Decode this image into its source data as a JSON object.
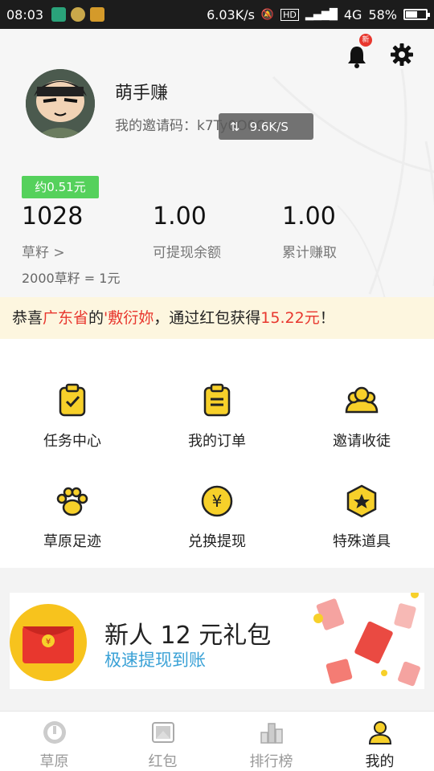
{
  "status_bar": {
    "time": "08:03",
    "speed": "6.03K/s",
    "network": "4G",
    "battery": "58%",
    "battery_level": 0.58
  },
  "header": {
    "bell_badge": "新",
    "nickname": "萌手赚",
    "invite_text": "我的邀请码：k7Ty0O0O >",
    "net_speed": "9.6K/S"
  },
  "stats": {
    "approx_badge": "约0.51元",
    "items": [
      {
        "value": "1028",
        "label": "草籽 >"
      },
      {
        "value": "1.00",
        "label": "可提现余额"
      },
      {
        "value": "1.00",
        "label": "累计赚取"
      }
    ],
    "rate": "2000草籽 = 1元"
  },
  "notice": {
    "prefix": "恭喜",
    "province": "广东省",
    "de": "的",
    "user": "'敷衍妳",
    "middle": "，通过红包获得",
    "amount": "15.22元",
    "suffix": "！"
  },
  "grid": [
    {
      "label": "任务中心",
      "icon": "clipboard-check-icon"
    },
    {
      "label": "我的订单",
      "icon": "clipboard-list-icon"
    },
    {
      "label": "邀请收徒",
      "icon": "group-icon"
    },
    {
      "label": "草原足迹",
      "icon": "paw-icon"
    },
    {
      "label": "兑换提现",
      "icon": "yuan-coin-icon"
    },
    {
      "label": "特殊道具",
      "icon": "star-hexagon-icon"
    }
  ],
  "banner": {
    "title": "新人 12 元礼包",
    "subtitle": "极速提现到账"
  },
  "tabs": [
    {
      "label": "草原",
      "icon": "grassland-icon",
      "active": false
    },
    {
      "label": "红包",
      "icon": "red-packet-icon",
      "active": false
    },
    {
      "label": "排行榜",
      "icon": "ranking-icon",
      "active": false
    },
    {
      "label": "我的",
      "icon": "profile-icon",
      "active": true
    }
  ],
  "colors": {
    "accent_yellow": "#f7d02a",
    "red": "#e8372e",
    "green_badge": "#55d15c",
    "blue_text": "#39a1d6"
  }
}
